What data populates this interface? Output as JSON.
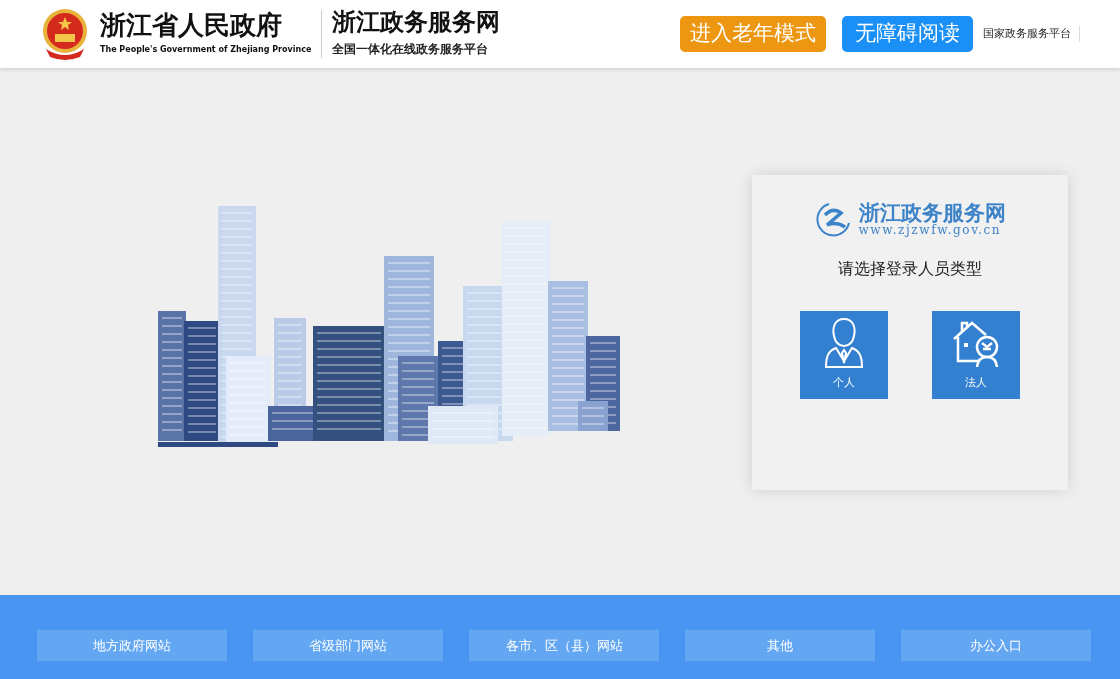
{
  "header": {
    "title": "浙江省人民政府",
    "title_en": "The People's Government of Zhejiang Province",
    "site_title": "浙江政务服务网",
    "site_subtitle": "全国一体化在线政务服务平台",
    "buttons": [
      {
        "label": "进入老年模式",
        "kind": "elder"
      },
      {
        "label": "无障碍阅读",
        "kind": "accessible"
      }
    ],
    "link": "国家政务服务平台"
  },
  "login": {
    "logo_title": "浙江政务服务网",
    "logo_url": "www.zjzwfw.gov.cn",
    "prompt": "请选择登录人员类型",
    "options": [
      {
        "label": "个人",
        "kind": "person"
      },
      {
        "label": "法人",
        "kind": "company"
      }
    ]
  },
  "footer": {
    "links": [
      "地方政府网站",
      "省级部门网站",
      "各市、区（县）网站",
      "其他",
      "办公入口"
    ]
  }
}
